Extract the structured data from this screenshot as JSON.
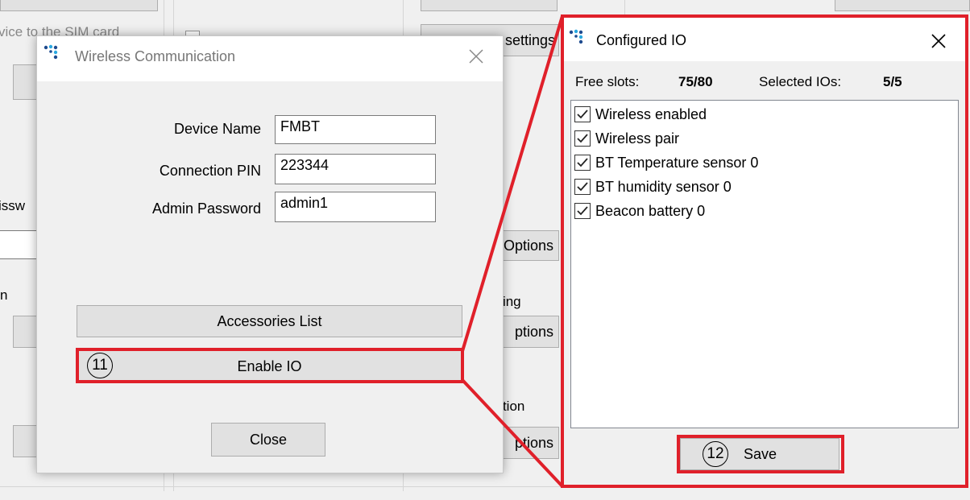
{
  "background": {
    "fragments": {
      "sim_card": "vice to the SIM card",
      "settings_button": "settings",
      "password": "issw",
      "options1": "Options",
      "n_label": "n",
      "fencing": "ncing",
      "options2": "ptions",
      "detection": "ection",
      "options3": "ptions"
    }
  },
  "wireless_dialog": {
    "title": "Wireless Communication",
    "fields": [
      {
        "label": "Device Name",
        "value": "FMBT"
      },
      {
        "label": "Connection PIN",
        "value": "223344"
      },
      {
        "label": "Admin Password",
        "value": "admin1"
      }
    ],
    "accessories_button": "Accessories List",
    "enable_io_button": "Enable IO",
    "close_button": "Close"
  },
  "configured_io_dialog": {
    "title": "Configured IO",
    "free_slots_label": "Free slots:",
    "free_slots_value": "75/80",
    "selected_ios_label": "Selected IOs:",
    "selected_ios_value": "5/5",
    "items": [
      {
        "label": "Wireless enabled",
        "checked": true
      },
      {
        "label": "Wireless pair",
        "checked": true
      },
      {
        "label": "BT Temperature sensor 0",
        "checked": true
      },
      {
        "label": "BT humidity sensor 0",
        "checked": true
      },
      {
        "label": "Beacon battery 0",
        "checked": true
      }
    ],
    "save_button": "Save"
  },
  "callouts": {
    "enable_io_number": "11",
    "save_number": "12"
  },
  "colors": {
    "highlight": "#e0202a",
    "button_bg": "#e1e1e1",
    "window_bg": "#f0f0f0"
  },
  "icons": {
    "app_icon": "teltonika-logo-icon",
    "close_icon": "close-icon",
    "checkbox_icon": "checkmark-icon"
  }
}
